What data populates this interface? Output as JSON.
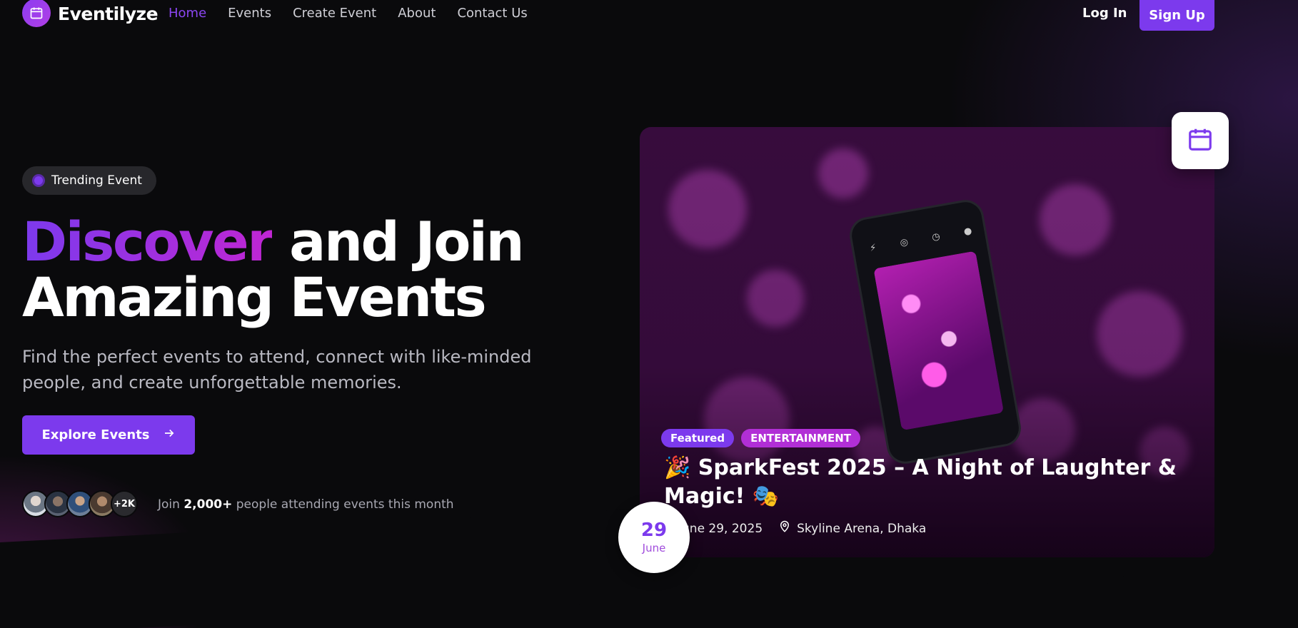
{
  "brand": {
    "name": "Eventilyze",
    "icon": "calendar-icon"
  },
  "nav": {
    "links": [
      "Home",
      "Events",
      "Create Event",
      "About",
      "Contact Us"
    ],
    "active": "Home",
    "login_label": "Log In",
    "signup_label": "Sign Up"
  },
  "hero": {
    "badge": "Trending Event",
    "headline_accent": "Discover",
    "headline_rest_1": " and Join",
    "headline_rest_2": "Amazing Events",
    "subtext": "Find the perfect events to attend, connect with like-minded people, and create unforgettable memories.",
    "cta_label": "Explore Events",
    "cta_icon": "arrow-right-icon",
    "avatars_more": "+2K",
    "join_prefix": "Join ",
    "join_count": "2,000+",
    "join_suffix": " people attending events this month"
  },
  "event_card": {
    "tags": [
      "Featured",
      "ENTERTAINMENT"
    ],
    "title": "🎉 SparkFest 2025 – A Night of Laughter & Magic! 🎭",
    "date_text": "June 29, 2025",
    "location": "Skyline Arena, Dhaka",
    "date_day": "29",
    "date_month": "June",
    "corner_icon": "calendar-icon"
  },
  "colors": {
    "accent": "#7c3aed",
    "accent_pink": "#c026d3",
    "background": "#0a0a0c"
  }
}
